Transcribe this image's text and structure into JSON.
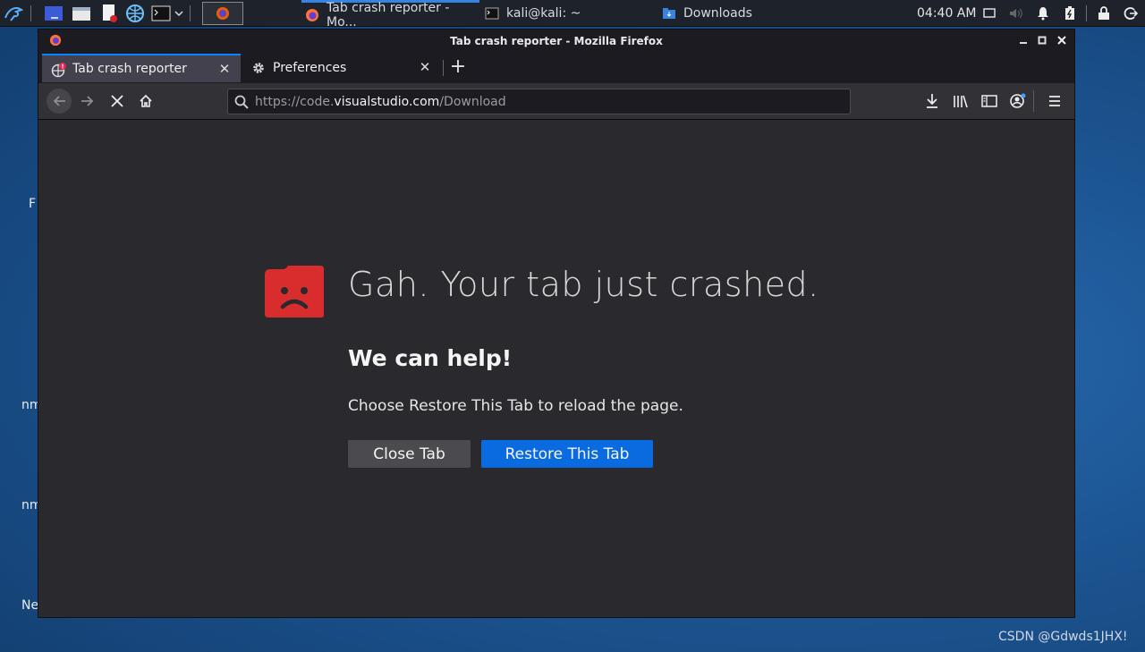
{
  "panel": {
    "taskbar_items": [
      {
        "label": "Tab crash reporter - Mo...",
        "icon": "firefox-icon"
      },
      {
        "label": "kali@kali: ~",
        "icon": "terminal-icon"
      },
      {
        "label": "Downloads",
        "icon": "folder-icon"
      }
    ],
    "clock": "04:40 AM"
  },
  "desktop": {
    "fragments": [
      "F",
      "nm",
      "nm",
      "Ne"
    ]
  },
  "window": {
    "title": "Tab crash reporter - Mozilla Firefox"
  },
  "tabs": [
    {
      "label": "Tab crash reporter",
      "selected": true
    },
    {
      "label": "Preferences",
      "selected": false
    }
  ],
  "urlbar": {
    "prefix": "https://code.",
    "host": "visualstudio.com",
    "path": "/Download"
  },
  "content": {
    "crash_title": "Gah. Your tab just crashed.",
    "help_title": "We can help!",
    "help_text": "Choose Restore This Tab to reload the page.",
    "close_button": "Close Tab",
    "restore_button": "Restore This Tab"
  },
  "watermark": "CSDN @Gdwds1JHX!",
  "colors": {
    "accent": "#0a84ff",
    "restore_button": "#0a6be0",
    "sad_tab_red": "#d92c2c"
  }
}
